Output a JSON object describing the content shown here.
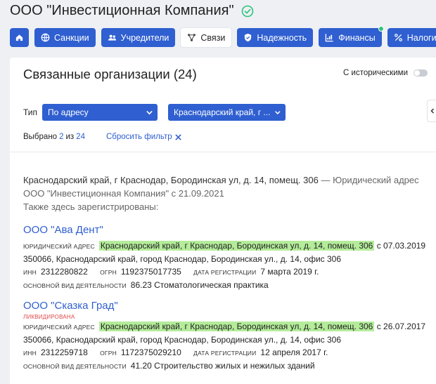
{
  "company": {
    "title": "ООО \"Инвестиционная Компания\""
  },
  "tabs": [
    {
      "label": "Санкции",
      "icon": "globe-icon"
    },
    {
      "label": "Учредители",
      "icon": "users-icon"
    },
    {
      "label": "Связи",
      "icon": "network-icon",
      "active": true
    },
    {
      "label": "Надежность",
      "icon": "shield-icon"
    },
    {
      "label": "Финансы",
      "icon": "chart-icon"
    },
    {
      "label": "Налоги",
      "icon": "percent-icon"
    }
  ],
  "panel": {
    "title": "Связанные организации (24)",
    "history_toggle_label": "С историческими"
  },
  "filters": {
    "type_label": "Тип",
    "type_value": "По адресу",
    "region_value": "Краснодарский край, г ..."
  },
  "selection": {
    "prefix": "Выбрано",
    "selected": "2",
    "of": "из",
    "total": "24",
    "reset_label": "Сбросить фильтр"
  },
  "address_block": {
    "address": "Краснодарский край, г Краснодар, Бородинская ул, д. 14, помещ. 306",
    "suffix": "— Юридический адрес",
    "line2": "ООО \"Инвестиционная Компания\" с 21.09.2021",
    "line3": "Также здесь зарегистрированы:"
  },
  "labels": {
    "legal_address": "юридический адрес",
    "inn": "ИНН",
    "ogrn": "ОГРН",
    "reg_date": "дата регистрации",
    "activity": "основной вид деятельности"
  },
  "orgs": [
    {
      "name": "ООО \"Ава Дент\"",
      "status": "",
      "legal_address": "Краснодарский край, г Краснодар, Бородинская ул, д. 14, помещ. 306",
      "since": "с 07.03.2019",
      "postal_address": "350066, Краснодарский край, город Краснодар, Бородинская ул., д. 14, офис 306",
      "inn": "2312280822",
      "ogrn": "1192375017735",
      "reg_date": "7 марта 2019 г.",
      "activity": "86.23 Стоматологическая практика"
    },
    {
      "name": "ООО \"Сказка Град\"",
      "status": "ликвидирована",
      "legal_address": "Краснодарский край, г Краснодар, Бородинская ул, д. 14, помещ. 306",
      "since": "с 26.07.2017",
      "postal_address": "350066, Краснодарский край, город Краснодар, Бородинская ул., д. 14, офис 306",
      "inn": "2312259718",
      "ogrn": "1172375029210",
      "reg_date": "12 апреля 2017 г.",
      "activity": "41.20 Строительство жилых и нежилых зданий"
    }
  ],
  "colors": {
    "accent": "#2f5fd0",
    "highlight": "#b4ec9a",
    "danger": "#e04848",
    "verified": "#2ec27e"
  }
}
